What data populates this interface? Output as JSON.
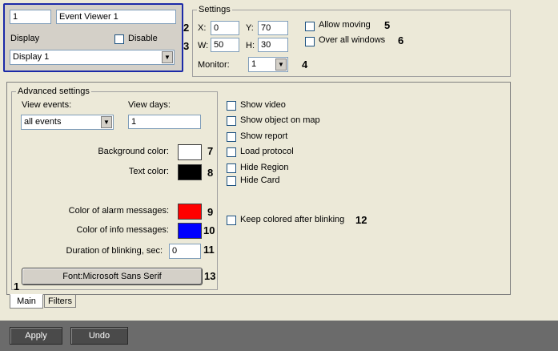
{
  "top_panel": {
    "id_value": "1",
    "name_value": "Event Viewer 1",
    "display_label": "Display",
    "disable_label": "Disable",
    "display_select": "Display 1"
  },
  "settings": {
    "legend": "Settings",
    "x_label": "X:",
    "x_value": "0",
    "y_label": "Y:",
    "y_value": "70",
    "w_label": "W:",
    "w_value": "50",
    "h_label": "H:",
    "h_value": "30",
    "monitor_label": "Monitor:",
    "monitor_value": "1",
    "allow_moving_label": "Allow moving",
    "over_all_label": "Over all windows"
  },
  "advanced": {
    "legend": "Advanced settings",
    "view_events_label": "View events:",
    "view_events_value": "all events",
    "view_days_label": "View days:",
    "view_days_value": "1",
    "bg_color_label": "Background color:",
    "text_color_label": "Text color:",
    "alarm_color_label": "Color of alarm messages:",
    "info_color_label": "Color of info messages:",
    "blink_label": "Duration of blinking, sec:",
    "blink_value": "0",
    "font_button": "Font:Microsoft Sans Serif"
  },
  "checks": {
    "show_video": "Show video",
    "show_map": "Show object on map",
    "show_report": "Show report",
    "load_protocol": "Load protocol",
    "hide_region": "Hide Region",
    "hide_card": "Hide Card",
    "keep_colored": "Keep colored after blinking"
  },
  "colors": {
    "background": "#ffffff",
    "text": "#000000",
    "alarm": "#ff0000",
    "info": "#0000ff"
  },
  "tabs": {
    "main": "Main",
    "filters": "Filters"
  },
  "buttons": {
    "apply": "Apply",
    "undo": "Undo"
  },
  "callouts": {
    "c1": "1",
    "c2": "2",
    "c3": "3",
    "c4": "4",
    "c5": "5",
    "c6": "6",
    "c7": "7",
    "c8": "8",
    "c9": "9",
    "c10": "10",
    "c11": "11",
    "c12": "12",
    "c13": "13"
  }
}
